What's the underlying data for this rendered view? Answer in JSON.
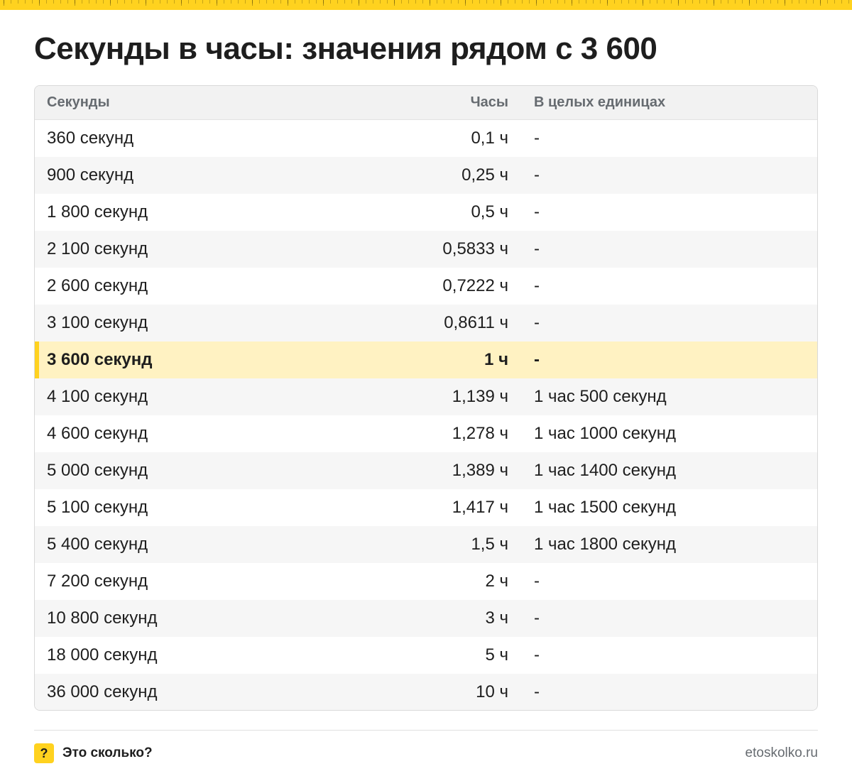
{
  "title": "Секунды в часы: значения рядом с 3 600",
  "colors": {
    "accent": "#ffd21f",
    "highlight": "#fff2c2",
    "header_bg": "#f2f2f2",
    "muted": "#666b70"
  },
  "table": {
    "headers": [
      "Секунды",
      "Часы",
      "В целых единицах"
    ],
    "highlighted_index": 6,
    "rows": [
      [
        "360 секунд",
        "0,1 ч",
        "-"
      ],
      [
        "900 секунд",
        "0,25 ч",
        "-"
      ],
      [
        "1 800 секунд",
        "0,5 ч",
        "-"
      ],
      [
        "2 100 секунд",
        "0,5833 ч",
        "-"
      ],
      [
        "2 600 секунд",
        "0,7222 ч",
        "-"
      ],
      [
        "3 100 секунд",
        "0,8611 ч",
        "-"
      ],
      [
        "3 600 секунд",
        "1 ч",
        "-"
      ],
      [
        "4 100 секунд",
        "1,139 ч",
        "1 час 500 секунд"
      ],
      [
        "4 600 секунд",
        "1,278 ч",
        "1 час 1000 секунд"
      ],
      [
        "5 000 секунд",
        "1,389 ч",
        "1 час 1400 секунд"
      ],
      [
        "5 100 секунд",
        "1,417 ч",
        "1 час 1500 секунд"
      ],
      [
        "5 400 секунд",
        "1,5 ч",
        "1 час 1800 секунд"
      ],
      [
        "7 200 секунд",
        "2 ч",
        "-"
      ],
      [
        "10 800 секунд",
        "3 ч",
        "-"
      ],
      [
        "18 000 секунд",
        "5 ч",
        "-"
      ],
      [
        "36 000 секунд",
        "10 ч",
        "-"
      ]
    ]
  },
  "footer": {
    "brand_icon": "?",
    "brand_name": "Это сколько?",
    "site": "etoskolko.ru"
  }
}
